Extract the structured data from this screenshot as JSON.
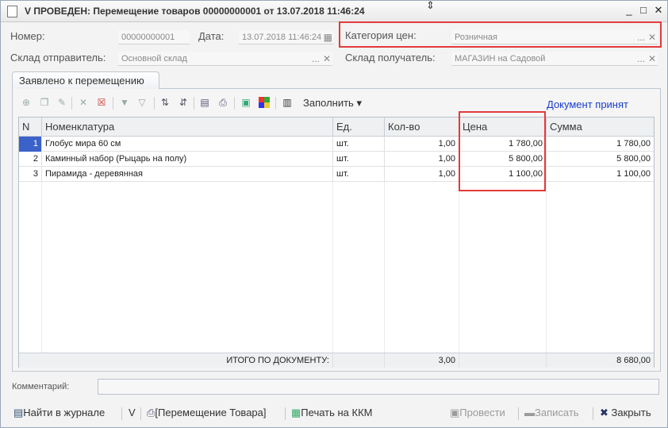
{
  "window": {
    "title": "V ПРОВЕДЕН: Перемещение товаров 00000000001 от 13.07.2018 11:46:24",
    "minimize_glyph": "_",
    "maximize_glyph": "□",
    "close_glyph": "✕"
  },
  "header": {
    "number_label": "Номер:",
    "number_value": "00000000001",
    "date_label": "Дата:",
    "date_value": "13.07.2018 11:46:24",
    "price_category_label": "Категория цен:",
    "price_category_value": "Розничная",
    "sender_label": "Склад отправитель:",
    "sender_value": "Основной склад",
    "receiver_label": "Склад получатель:",
    "receiver_value": "МАГАЗИН на Садовой",
    "select_glyph": "...",
    "clear_glyph": "✕"
  },
  "tab": {
    "label": "Заявлено к перемещению"
  },
  "toolbar": {
    "fill_label": "Заполнить",
    "status_link": "Документ принят",
    "icons": [
      "add-icon",
      "copy-icon",
      "edit-icon",
      "delete-icon",
      "cancel-icon",
      "filter-icon",
      "filter-off-icon",
      "sort-asc-icon",
      "sort-desc-icon",
      "properties-icon",
      "print-icon",
      "picture-icon",
      "colors-icon",
      "barcode-icon"
    ]
  },
  "table": {
    "columns": [
      "N",
      "Номенклатура",
      "Ед.",
      "Кол-во",
      "Цена",
      "Сумма"
    ],
    "rows": [
      {
        "n": "1",
        "item": "Глобус мира 60 см",
        "unit": "шт.",
        "qty": "1,00",
        "price": "1 780,00",
        "sum": "1 780,00"
      },
      {
        "n": "2",
        "item": "Каминный набор (Рыцарь на полу)",
        "unit": "шт.",
        "qty": "1,00",
        "price": "5 800,00",
        "sum": "5 800,00"
      },
      {
        "n": "3",
        "item": "Пирамида - деревянная",
        "unit": "шт.",
        "qty": "1,00",
        "price": "1 100,00",
        "sum": "1 100,00"
      }
    ],
    "footer": {
      "label": "ИТОГО ПО ДОКУМЕНТУ:",
      "qty": "3,00",
      "sum": "8 680,00"
    }
  },
  "comment": {
    "label": "Комментарий:",
    "value": ""
  },
  "bottom_bar": {
    "find_in_journal": "Найти в журнале",
    "v_label": "V",
    "print_form": "[Перемещение Товара]",
    "print_kkm": "Печать на ККМ",
    "post": "Провести",
    "save": "Записать",
    "close": "Закрыть"
  },
  "colors": {
    "highlight_box": "#e23b3b",
    "link": "#1a3ccd",
    "selected_cell": "#3a62c9"
  }
}
